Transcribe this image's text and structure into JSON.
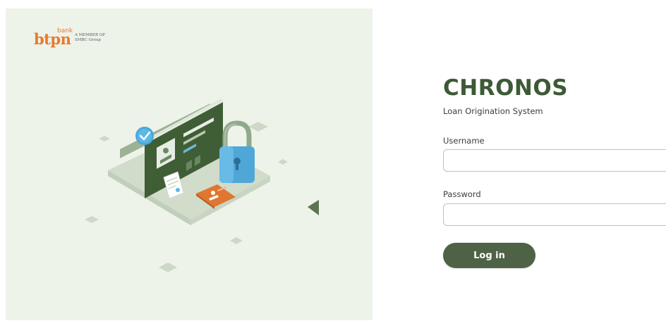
{
  "brand": {
    "logo_small": "bank",
    "logo_main": "btpn",
    "logo_member_line1": "A MEMBER OF",
    "logo_member_line2": "SMBC Group",
    "accent_color": "#e87a2c"
  },
  "app": {
    "title": "CHRONOS",
    "subtitle": "Loan Origination System",
    "primary_color": "#4e6246",
    "panel_color": "#eef3ea"
  },
  "form": {
    "username_label": "Username",
    "username_value": "",
    "password_label": "Password",
    "password_value": "",
    "login_label": "Log in"
  },
  "icons": {
    "check": "check-badge-icon",
    "lock": "padlock-icon",
    "profile": "profile-card-icon",
    "document": "document-icon",
    "id_card": "id-card-icon"
  }
}
